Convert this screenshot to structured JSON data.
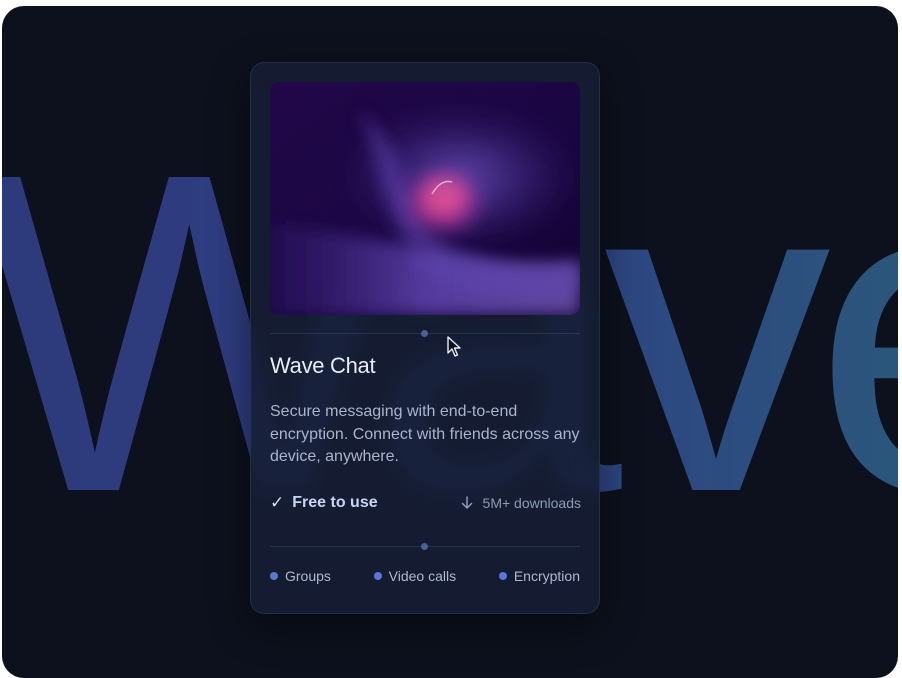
{
  "background": {
    "word": "Wave"
  },
  "card": {
    "title": "Wave Chat",
    "description": "Secure messaging with end-to-end encryption. Connect with friends across any device, anywhere.",
    "pricing": {
      "icon": "check-icon",
      "label": "Free to use"
    },
    "downloads": {
      "icon": "download-arrow-icon",
      "label": "5M+ downloads"
    },
    "tags": [
      {
        "label": "Groups"
      },
      {
        "label": "Video calls"
      },
      {
        "label": "Encryption"
      }
    ],
    "hero_image": {
      "description_icon": "abstract-wave-image"
    }
  },
  "colors": {
    "background": "#0c111d",
    "card": "#161e34",
    "accent": "#5b77d6",
    "word_gradient_start": "#2d3a7a",
    "word_gradient_end": "#2a6078",
    "hero_pink": "#ff3d8f",
    "hero_purple": "#6a4fc4"
  }
}
